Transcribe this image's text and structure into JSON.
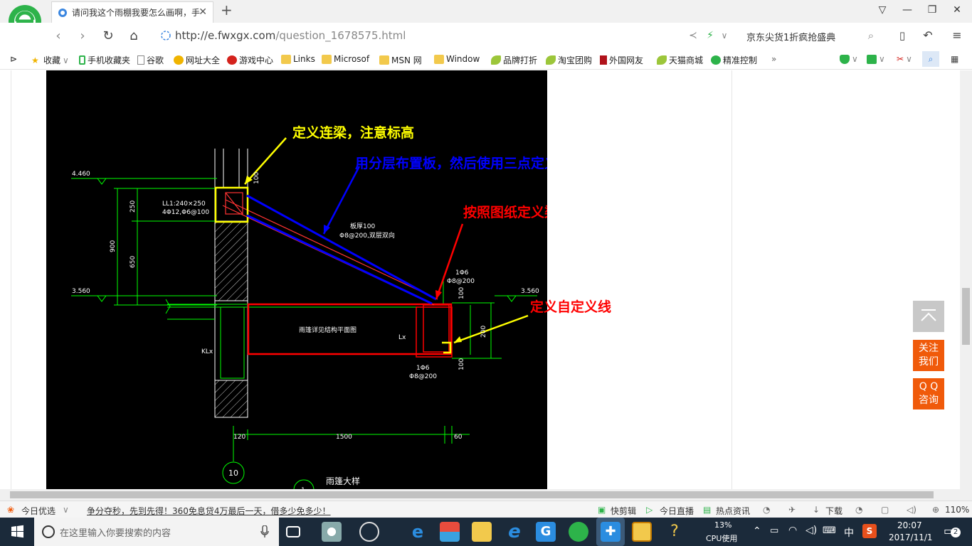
{
  "browser": {
    "tab_title": "请问我这个雨棚我要怎么画啊，手",
    "url_main": "http://e.fwxgx.com",
    "url_path": "/question_1678575.html",
    "search_query": "京东尖货1折疯抢盛典"
  },
  "bookmarks": [
    {
      "label": "收藏",
      "icon": "star-icon"
    },
    {
      "label": "手机收藏夹",
      "icon": "phone-icon"
    },
    {
      "label": "谷歌",
      "icon": "page-icon"
    },
    {
      "label": "网址大全",
      "icon": "globe-icon"
    },
    {
      "label": "游戏中心",
      "icon": "game-icon"
    },
    {
      "label": "Links",
      "icon": "folder-icon"
    },
    {
      "label": "Microsof",
      "icon": "folder-icon"
    },
    {
      "label": "MSN 网",
      "icon": "folder-icon"
    },
    {
      "label": "Window",
      "icon": "folder-icon"
    },
    {
      "label": "品牌打折",
      "icon": "leaf-icon"
    },
    {
      "label": "淘宝团购",
      "icon": "leaf-icon"
    },
    {
      "label": "外国网友",
      "icon": "flag-icon"
    },
    {
      "label": "天猫商城",
      "icon": "leaf-icon"
    },
    {
      "label": "精准控制",
      "icon": "chat-icon"
    }
  ],
  "cad": {
    "annotations": [
      {
        "text": "定义连梁，注意标高",
        "color": "#ffff00"
      },
      {
        "text": "用分层布置板，然后使用三点定义斜板功能",
        "color": "#0000ff"
      },
      {
        "text": "按照图纸定义梁，板",
        "color": "#ff0000"
      },
      {
        "text": "定义自定义线",
        "color": "#ffff00"
      }
    ],
    "labels": {
      "elev_top": "4.460",
      "elev_left": "3.560",
      "elev_right": "3.560",
      "beam_ll": "LL1:240×250",
      "beam_ll_rebar": "4Φ12,Φ6@100",
      "dim_100a": "100",
      "dim_250": "250",
      "dim_900": "900",
      "dim_650": "650",
      "slab_note1": "板厚100",
      "slab_note2": "Φ8@200,双层双向",
      "rebar_1": "1Φ6",
      "rebar_2": "Φ8@200",
      "dim_100b": "100",
      "dim_200": "200",
      "dim_400": "400",
      "dim_100c": "100",
      "slab_plan": "雨篷详见结构平面图",
      "lx": "Lx",
      "klx": "KLx",
      "rebar_3": "1Φ6",
      "rebar_4": "Φ8@200",
      "dim_120": "120",
      "dim_1500": "1500",
      "dim_60": "60",
      "axis": "10",
      "detail_title": "雨篷大样",
      "detail_no": "1"
    }
  },
  "floats": {
    "follow": "关注\n我们",
    "follow_1": "关注",
    "follow_2": "我们",
    "qq_1": "Q Q",
    "qq_2": "咨询"
  },
  "statusbar": {
    "today": "今日优选",
    "news": "争分夺秒，先到先得！360免息贷4万最后一天，借多少免多少！",
    "quick_clip": "快剪辑",
    "live": "今日直播",
    "hot_news": "热点资讯",
    "download": "下载",
    "zoom": "110%"
  },
  "taskbar": {
    "search_placeholder": "在这里输入你要搜索的内容",
    "cpu_percent": "13%",
    "cpu_label": "CPU使用",
    "ime": "中",
    "time": "20:07",
    "date": "2017/11/1",
    "notifications": "2"
  },
  "colors": {
    "cad_bg": "#000000",
    "cad_green": "#00ff00",
    "cad_red": "#ff0000",
    "cad_yellow": "#ffff00",
    "cad_blue": "#0000ff",
    "accent_orange": "#f05a0a"
  }
}
